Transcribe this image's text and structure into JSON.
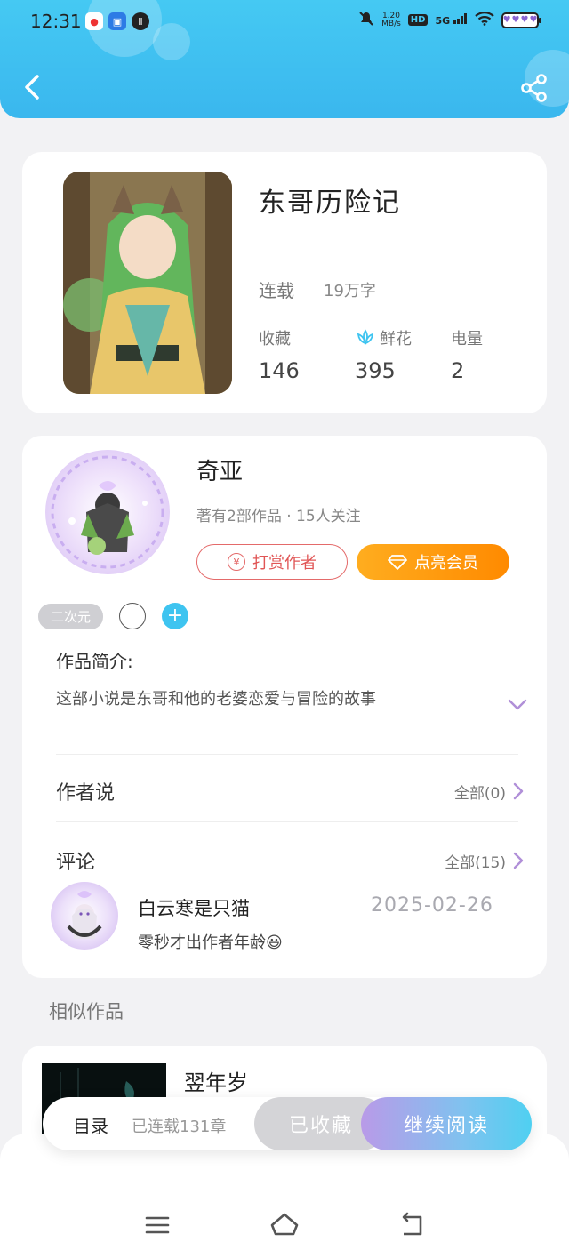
{
  "status_bar": {
    "time": "12:31",
    "net_speed_value": "1.20",
    "net_speed_unit": "MB/s",
    "hd": "HD",
    "signal": "5G"
  },
  "header": {
    "back_icon": "chevron-left-icon",
    "share_icon": "share-icon",
    "color": "#3ab7ee"
  },
  "book": {
    "title": "东哥历险记",
    "status": "连载",
    "word_count": "19万字",
    "stats": [
      {
        "label": "收藏",
        "value": "146",
        "icon": ""
      },
      {
        "label": "鲜花",
        "value": "395",
        "icon": "lotus-icon"
      },
      {
        "label": "电量",
        "value": "2",
        "icon": ""
      }
    ]
  },
  "author": {
    "name": "奇亚",
    "summary": "著有2部作品 · 15人关注",
    "reward_label": "打赏作者",
    "vip_label": "点亮会员",
    "tags": [
      "二次元"
    ],
    "intro_title": "作品简介:",
    "intro_text": "这部小说是东哥和他的老婆恋爱与冒险的故事"
  },
  "author_says": {
    "title": "作者说",
    "more": "全部(0)"
  },
  "comments": {
    "title": "评论",
    "more": "全部(15)",
    "items": [
      {
        "user": "白云寒是只猫",
        "date": "2025-02-26",
        "text": "零秒才出作者年龄😃"
      }
    ]
  },
  "similar": {
    "title": "相似作品",
    "items": [
      {
        "name": "翌年岁"
      }
    ]
  },
  "action_bar": {
    "toc": "目录",
    "chapters": "已连载131章",
    "favorited": "已收藏",
    "continue": "继续阅读"
  },
  "nav": {
    "menu_icon": "menu-icon",
    "home_icon": "home-icon",
    "back_icon": "return-icon"
  },
  "colors": {
    "accent": "#3ec4f0",
    "reward": "#e05555",
    "vip": "#ff9a0f",
    "chevron": "#b08fd8"
  }
}
